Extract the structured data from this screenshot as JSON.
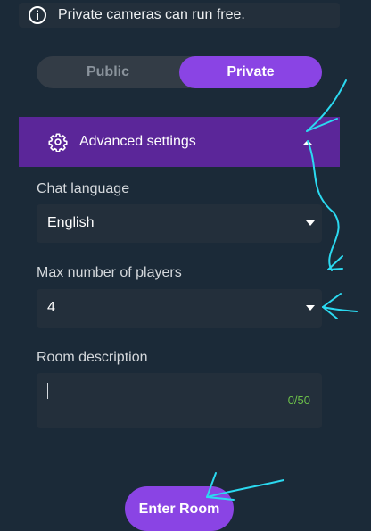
{
  "banner": {
    "text": "Private cameras can run free.",
    "icon": "info-icon"
  },
  "visibility_toggle": {
    "options": [
      "Public",
      "Private"
    ],
    "selected": "Private"
  },
  "advanced_settings": {
    "label": "Advanced settings",
    "expanded": true,
    "icon": "gear-icon"
  },
  "form": {
    "chat_language": {
      "label": "Chat language",
      "value": "English"
    },
    "max_players": {
      "label": "Max number of players",
      "value": "4"
    },
    "room_description": {
      "label": "Room description",
      "value": "",
      "counter": "0/50"
    }
  },
  "enter_button": {
    "label": "Enter Room"
  },
  "colors": {
    "background": "#1b2a38",
    "accent": "#8a44e4",
    "advanced_header": "#5b2699",
    "counter": "#6cc04a",
    "annotation": "#2bd9f0"
  }
}
